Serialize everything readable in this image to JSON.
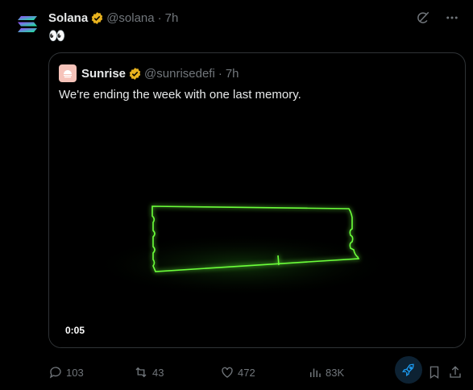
{
  "post": {
    "author_name": "Solana",
    "handle": "@solana",
    "time": "7h",
    "text": "👀"
  },
  "quote": {
    "author_name": "Sunrise",
    "handle": "@sunrisedefi",
    "time": "7h",
    "text": "We're ending the week with one last memory.",
    "video_time": "0:05"
  },
  "actions": {
    "replies": "103",
    "reposts": "43",
    "likes": "472",
    "views": "83K"
  },
  "colors": {
    "background": "#000000",
    "muted": "#71767b",
    "verified": "#e8b21e",
    "neon": "#6cff3a"
  }
}
